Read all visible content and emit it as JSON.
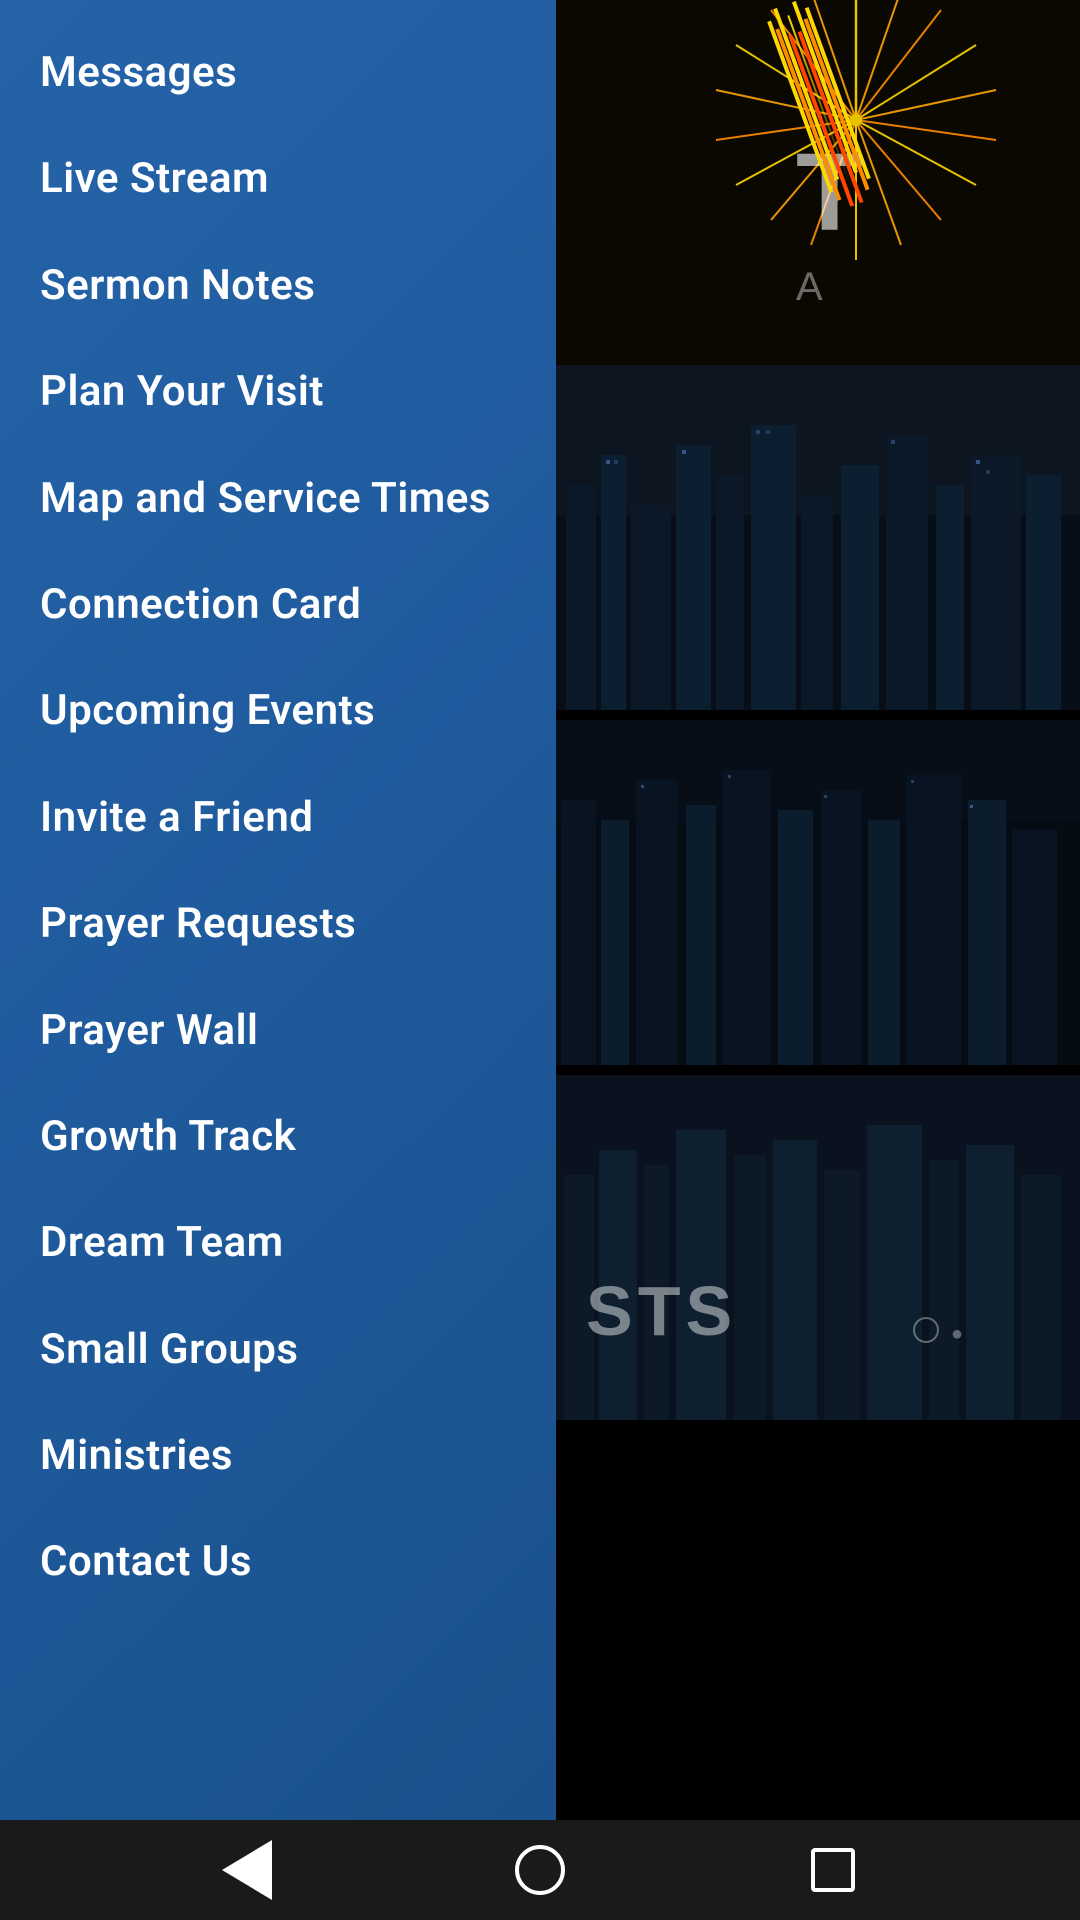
{
  "menu": {
    "items": [
      {
        "id": "messages",
        "label": "Messages"
      },
      {
        "id": "live-stream",
        "label": "Live Stream"
      },
      {
        "id": "sermon-notes",
        "label": "Sermon Notes"
      },
      {
        "id": "plan-your-visit",
        "label": "Plan Your Visit"
      },
      {
        "id": "map-and-service-times",
        "label": "Map and Service Times"
      },
      {
        "id": "connection-card",
        "label": "Connection Card"
      },
      {
        "id": "upcoming-events",
        "label": "Upcoming Events"
      },
      {
        "id": "invite-a-friend",
        "label": "Invite a Friend"
      },
      {
        "id": "prayer-requests",
        "label": "Prayer Requests"
      },
      {
        "id": "prayer-wall",
        "label": "Prayer Wall"
      },
      {
        "id": "growth-track",
        "label": "Growth Track"
      },
      {
        "id": "dream-team",
        "label": "Dream Team"
      },
      {
        "id": "small-groups",
        "label": "Small Groups"
      },
      {
        "id": "ministries",
        "label": "Ministries"
      },
      {
        "id": "contact-us",
        "label": "Contact Us"
      }
    ]
  },
  "background": {
    "overlay_text": "STS"
  },
  "bottom_nav": {
    "back_label": "back",
    "home_label": "home",
    "recent_label": "recent"
  }
}
